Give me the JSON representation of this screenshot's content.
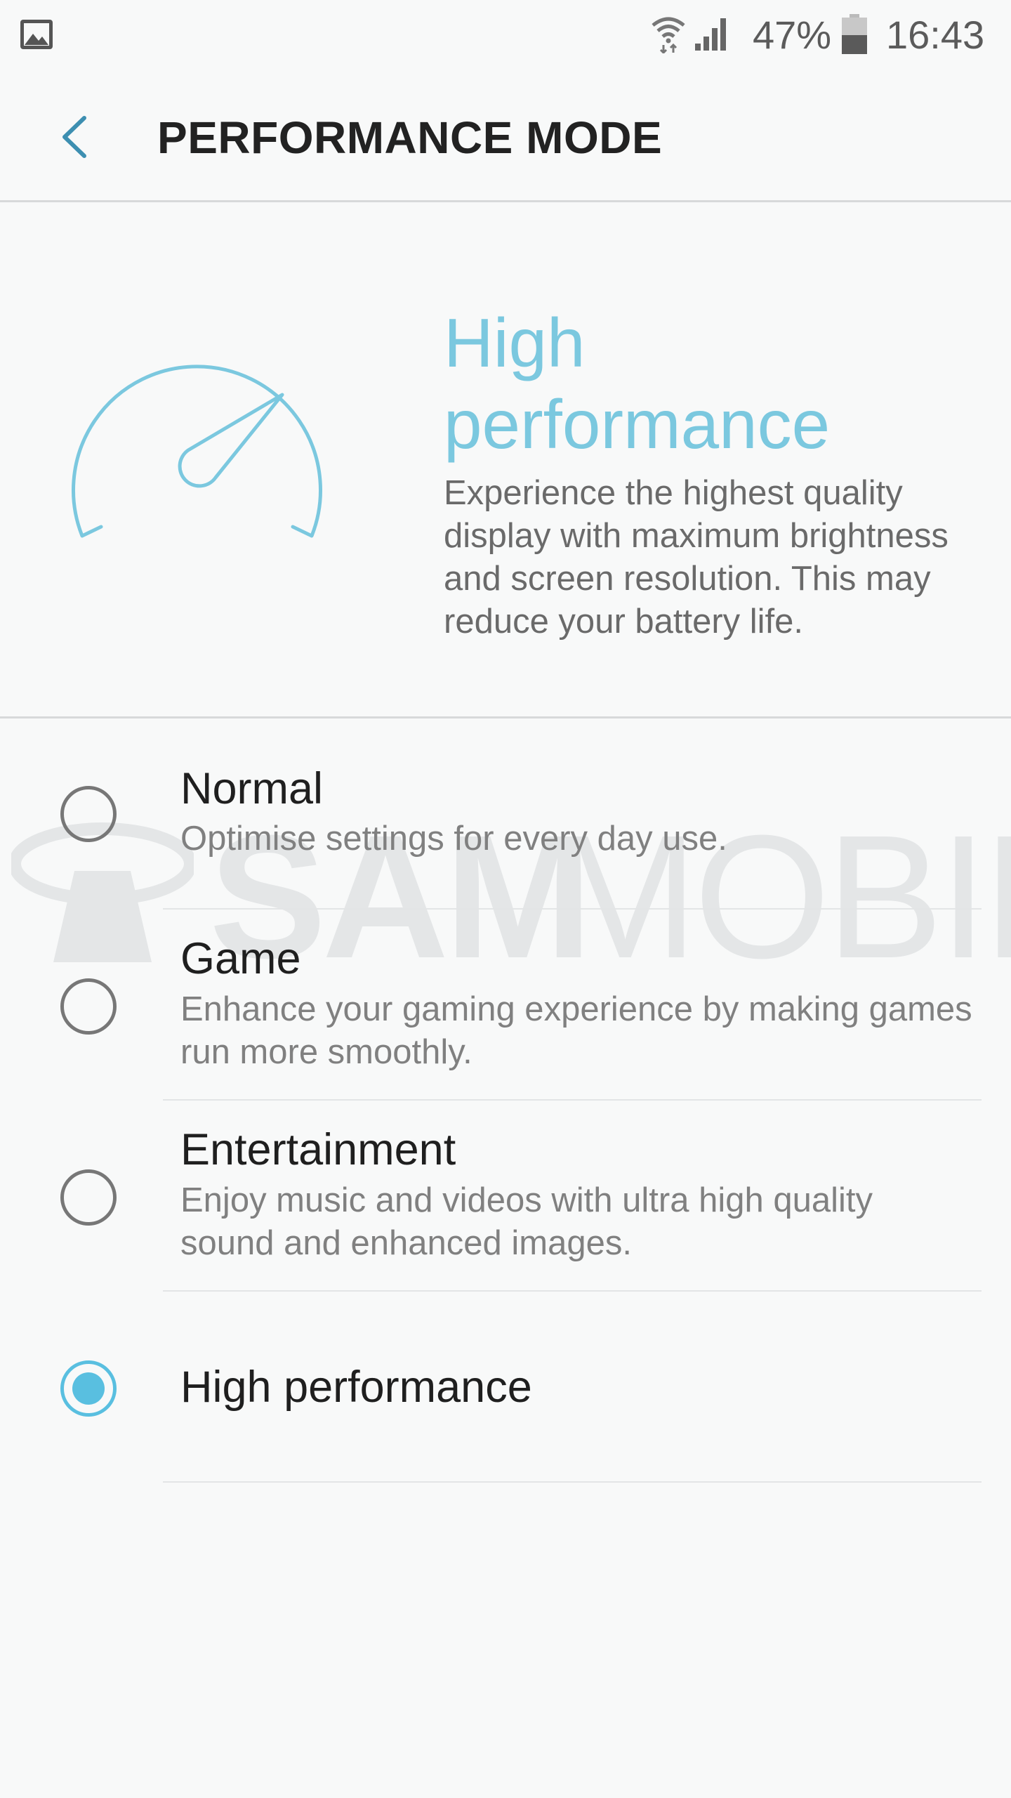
{
  "status_bar": {
    "battery_percent": "47%",
    "time": "16:43",
    "icons": [
      "gallery-notification-icon",
      "wifi-icon",
      "signal-icon",
      "battery-icon"
    ]
  },
  "app_bar": {
    "title": "PERFORMANCE MODE",
    "back_icon": "chevron-left-icon"
  },
  "hero": {
    "icon": "speedometer-icon",
    "title": "High performance",
    "description": "Experience the highest quality display with maximum brightness and screen resolution. This may reduce your battery life."
  },
  "options": [
    {
      "title": "Normal",
      "description": "Optimise settings for every day use.",
      "selected": false
    },
    {
      "title": "Game",
      "description": "Enhance your gaming experience by making games run more smoothly.",
      "selected": false
    },
    {
      "title": "Entertainment",
      "description": "Enjoy music and videos with ultra high quality sound and enhanced images.",
      "selected": false
    },
    {
      "title": "High performance",
      "description": "",
      "selected": true
    }
  ],
  "watermark": {
    "bold": "SAM",
    "light": "MOBILE"
  },
  "colors": {
    "accent": "#59bfe0",
    "hero_text": "#7bc8df",
    "background": "#f8f9f9"
  }
}
